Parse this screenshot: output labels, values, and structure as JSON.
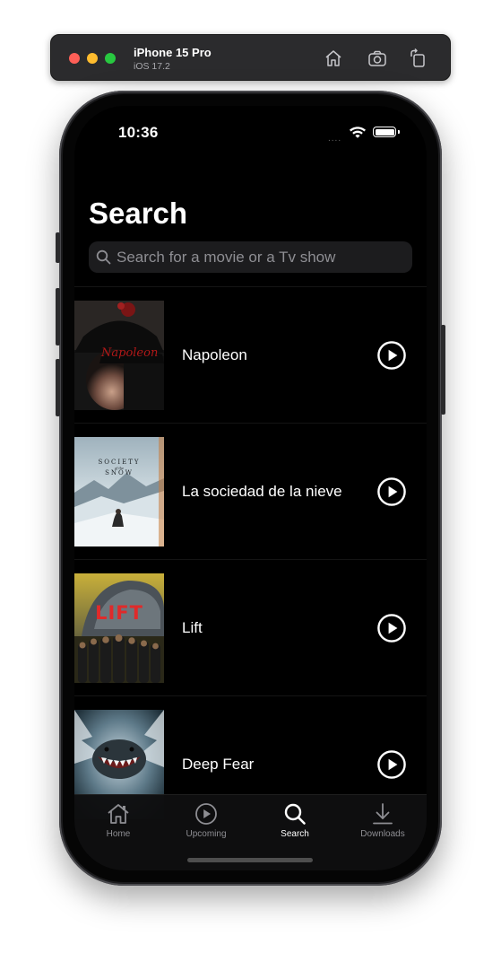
{
  "simulator": {
    "device_name": "iPhone 15 Pro",
    "os_version": "iOS 17.2",
    "buttons": [
      {
        "name": "home-icon"
      },
      {
        "name": "screenshot-icon"
      },
      {
        "name": "rotate-icon"
      }
    ]
  },
  "status_bar": {
    "time": "10:36",
    "signal": "....",
    "icons": [
      "wifi-icon",
      "battery-icon"
    ]
  },
  "page": {
    "title": "Search"
  },
  "search": {
    "placeholder": "Search for a movie or a Tv show",
    "value": "",
    "icon": "magnifier-icon"
  },
  "results": [
    {
      "title": "Napoleon",
      "poster": "napoleon-poster",
      "action_icon": "play-circle-icon"
    },
    {
      "title": "La sociedad de la nieve",
      "poster": "society-of-the-snow-poster",
      "action_icon": "play-circle-icon"
    },
    {
      "title": "Lift",
      "poster": "lift-poster",
      "action_icon": "play-circle-icon"
    },
    {
      "title": "Deep Fear",
      "poster": "deep-fear-poster",
      "action_icon": "play-circle-icon"
    }
  ],
  "tab_bar": {
    "tabs": [
      {
        "label": "Home",
        "icon": "house-icon",
        "active": false
      },
      {
        "label": "Upcoming",
        "icon": "play-circle-icon",
        "active": false
      },
      {
        "label": "Search",
        "icon": "magnifier-icon",
        "active": true
      },
      {
        "label": "Downloads",
        "icon": "download-icon",
        "active": false
      }
    ]
  },
  "colors": {
    "background": "#000000",
    "text": "#ffffff",
    "search_field": "#1c1c1e",
    "placeholder": "#8e8e93",
    "tab_inactive": "#8e8e93",
    "tab_active": "#ffffff"
  }
}
